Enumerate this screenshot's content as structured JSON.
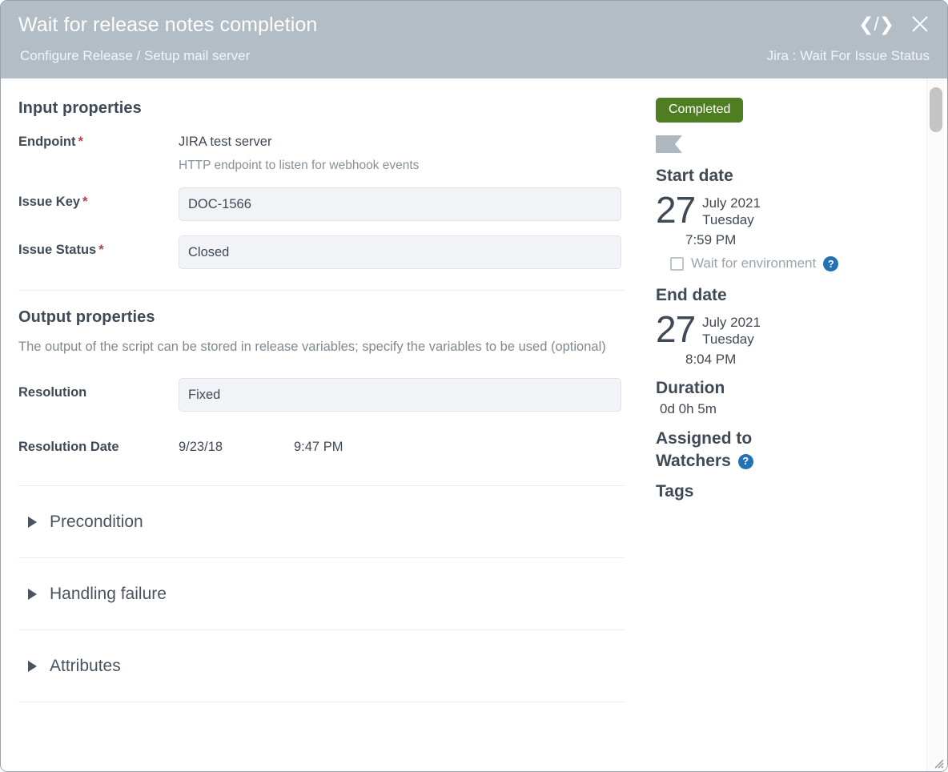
{
  "header": {
    "title": "Wait for release notes completion",
    "breadcrumb": "Configure Release / Setup mail server",
    "task_type": "Jira : Wait For Issue Status",
    "code_icon": "code-icon",
    "close_icon": "close-icon"
  },
  "input_section": {
    "title": "Input properties",
    "endpoint": {
      "label": "Endpoint",
      "required": "*",
      "value": "JIRA test server",
      "hint": "HTTP endpoint to listen for webhook events"
    },
    "issue_key": {
      "label": "Issue Key",
      "required": "*",
      "value": "DOC-1566"
    },
    "issue_status": {
      "label": "Issue Status",
      "required": "*",
      "value": "Closed"
    }
  },
  "output_section": {
    "title": "Output properties",
    "description": "The output of the script can be stored in release variables; specify the variables to be used (optional)",
    "resolution": {
      "label": "Resolution",
      "value": "Fixed"
    },
    "resolution_date": {
      "label": "Resolution Date",
      "date": "9/23/18",
      "time": "9:47 PM"
    }
  },
  "accordions": [
    {
      "label": "Precondition"
    },
    {
      "label": "Handling failure"
    },
    {
      "label": "Attributes"
    }
  ],
  "sidebar": {
    "status": "Completed",
    "status_color": "#4e7d22",
    "flag_icon": "flag-icon",
    "start_date": {
      "heading": "Start date",
      "day": "27",
      "month_year": "July 2021",
      "weekday": "Tuesday",
      "time": "7:59 PM"
    },
    "wait_for_environment": {
      "label": "Wait for environment",
      "checked": false,
      "help": "?"
    },
    "end_date": {
      "heading": "End date",
      "day": "27",
      "month_year": "July 2021",
      "weekday": "Tuesday",
      "time": "8:04 PM"
    },
    "duration": {
      "heading": "Duration",
      "value": "0d 0h 5m"
    },
    "assigned_to": {
      "heading": "Assigned to"
    },
    "watchers": {
      "heading": "Watchers",
      "help": "?"
    },
    "tags": {
      "heading": "Tags"
    }
  }
}
